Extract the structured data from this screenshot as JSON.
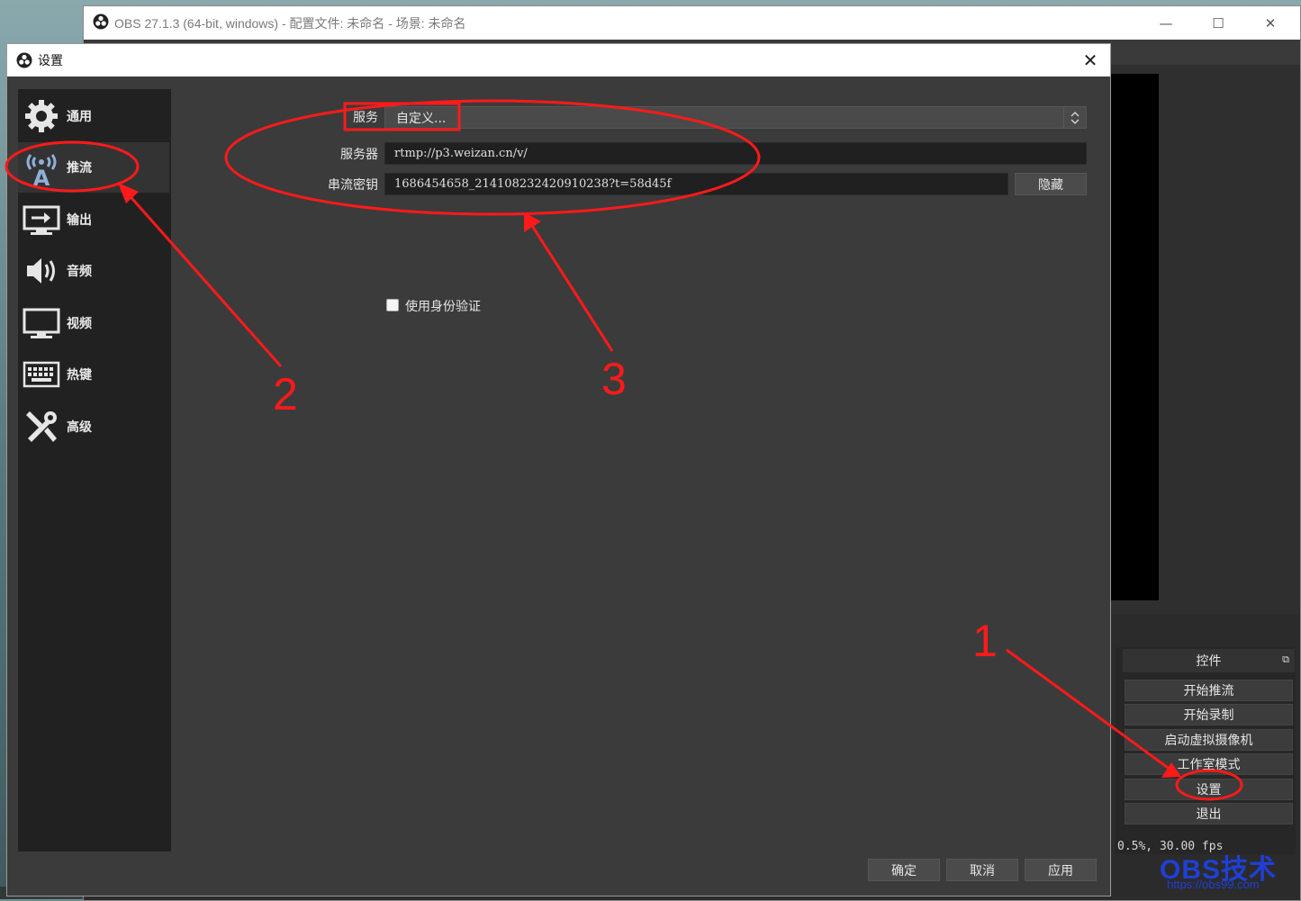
{
  "main_window": {
    "title": "OBS 27.1.3 (64-bit, windows) - 配置文件: 未命名 - 场景: 未命名",
    "minimize": "—",
    "maximize": "☐",
    "close": "✕"
  },
  "controls_dock": {
    "title": "控件",
    "buttons": [
      "开始推流",
      "开始录制",
      "启动虚拟摄像机",
      "工作室模式",
      "设置",
      "退出"
    ]
  },
  "status_bar": {
    "stats": "0.5%, 30.00 fps"
  },
  "watermark": {
    "brand": "OBS技术",
    "url": "https://obs99.com"
  },
  "settings_dialog": {
    "title": "设置",
    "close": "✕",
    "sidebar": [
      {
        "label": "通用",
        "icon": "gear-icon"
      },
      {
        "label": "推流",
        "icon": "broadcast-antenna-icon"
      },
      {
        "label": "输出",
        "icon": "output-icon"
      },
      {
        "label": "音频",
        "icon": "speaker-icon"
      },
      {
        "label": "视频",
        "icon": "monitor-icon"
      },
      {
        "label": "热键",
        "icon": "keyboard-icon"
      },
      {
        "label": "高级",
        "icon": "tools-icon"
      }
    ],
    "active_item": "推流",
    "stream": {
      "service_label": "服务",
      "service_value": "自定义...",
      "server_label": "服务器",
      "server_value": "rtmp://p3.weizan.cn/v/",
      "key_label": "串流密钥",
      "key_value": "1686454658_214108232420910238?t=58d45f",
      "hide_button": "隐藏",
      "auth_checkbox_label": "使用身份验证",
      "auth_checked": false
    },
    "footer": {
      "ok": "确定",
      "cancel": "取消",
      "apply": "应用"
    }
  },
  "annotations": {
    "step1": "1",
    "step2": "2",
    "step3": "3"
  },
  "colors": {
    "annotation_red": "#ff1a1a",
    "dialog_bg": "#3b3b3b",
    "sidebar_bg": "#212121"
  }
}
